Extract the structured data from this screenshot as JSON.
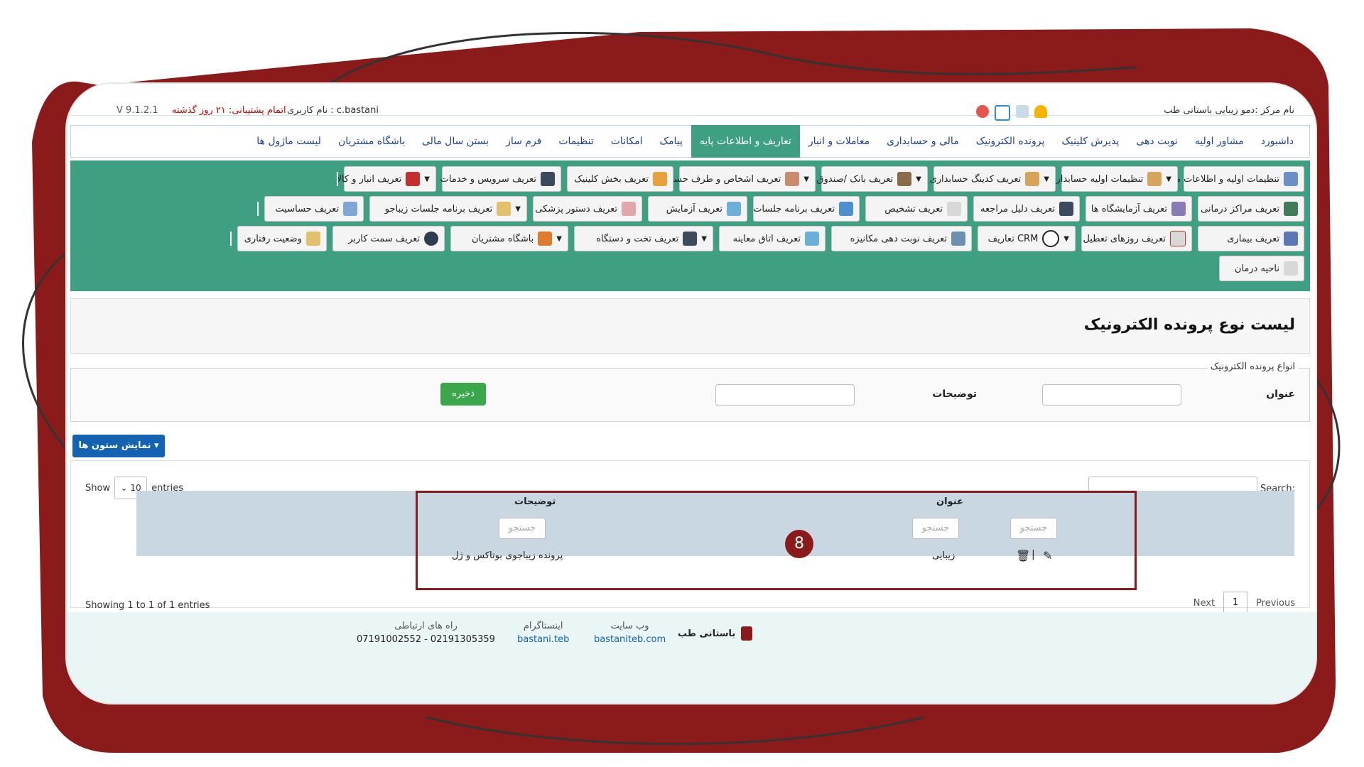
{
  "colors": {
    "accent": "#3f9f83",
    "frame": "#8b1a1a",
    "primary": "#1462b2",
    "save": "#3aa84a",
    "nav_text": "#1d3d8f"
  },
  "topbar": {
    "version": "V 9.1.2.1",
    "support": "اتمام پشتیبانی: ۲۱ روز گذشته",
    "user": "نام کاربری : c.bastani",
    "center": "نام مرکز :دمو زیبایی باستانی طب",
    "icons": [
      "power-icon",
      "checkbox-icon",
      "message-icon",
      "bell-icon"
    ]
  },
  "nav": {
    "items": [
      {
        "label": "داشبورد"
      },
      {
        "label": "مشاور اولیه"
      },
      {
        "label": "نوبت دهی"
      },
      {
        "label": "پذیرش کلینیک"
      },
      {
        "label": "پرونده الکترونیک"
      },
      {
        "label": "مالی و حسابداری"
      },
      {
        "label": "معاملات و انبار"
      },
      {
        "label": "تعاریف و اطلاعات پایه",
        "active": true
      },
      {
        "label": "پیامک"
      },
      {
        "label": "امکانات"
      },
      {
        "label": "تنظیمات"
      },
      {
        "label": "فرم ساز"
      },
      {
        "label": "بستن سال مالی"
      },
      {
        "label": "باشگاه مشتریان"
      },
      {
        "label": "لیست ماژول ها"
      }
    ]
  },
  "submenu": {
    "row1": [
      {
        "label": "تنظیمات اولیه و اطلاعات مرکز",
        "icon": "building-icon"
      },
      {
        "label": "تنظیمات اولیه حسابداری",
        "icon": "settings-icon",
        "dropdown": true
      },
      {
        "label": "تعریف کدینگ حسابداری",
        "icon": "coding-icon",
        "dropdown": true
      },
      {
        "label": "تعریف بانک /صندوق",
        "icon": "bank-icon",
        "dropdown": true
      },
      {
        "label": "تعریف اشخاص و طرف حساب",
        "icon": "person-icon",
        "dropdown": true
      },
      {
        "label": "تعریف بخش کلینیک",
        "icon": "grid-icon"
      },
      {
        "label": "تعریف سرویس و خدمات",
        "icon": "monitor-icon"
      },
      {
        "label": "تعریف انبار و کالا",
        "icon": "box-icon",
        "dropdown": true
      }
    ],
    "row2": [
      {
        "label": "تعریف مراکز درمانی",
        "icon": "clinic-icon"
      },
      {
        "label": "تعریف آزمایشگاه ها",
        "icon": "lab-icon"
      },
      {
        "label": "تعریف دلیل مراجعه",
        "icon": "reason-icon"
      },
      {
        "label": "تعریف تشخیص",
        "icon": "diagnosis-icon"
      },
      {
        "label": "تعریف برنامه جلسات",
        "icon": "checklist-icon"
      },
      {
        "label": "تعریف آزمایش",
        "icon": "flask-icon"
      },
      {
        "label": "تعریف دستور پزشکی",
        "icon": "bottle-icon"
      },
      {
        "label": "تعریف برنامه جلسات زیباجو",
        "icon": "beauty-icon",
        "dropdown": true
      },
      {
        "label": "تعریف حساسیت",
        "icon": "allergy-icon"
      }
    ],
    "row3": [
      {
        "label": "تعریف بیماری",
        "icon": "patient-icon"
      },
      {
        "label": "تعریف روزهای تعطیل",
        "icon": "calendar-icon"
      },
      {
        "label": "تعاریف CRM",
        "icon": "crm-icon",
        "dropdown": true
      },
      {
        "label": "تعریف نوبت دهی مکانیزه",
        "icon": "queue-icon"
      },
      {
        "label": "تعریف اتاق معاینه",
        "icon": "room-icon"
      },
      {
        "label": "تعریف تخت و دستگاه",
        "icon": "bed-icon",
        "dropdown": true
      },
      {
        "label": "باشگاه مشتریان",
        "icon": "group-icon",
        "dropdown": true
      },
      {
        "label": "تعریف سمت کاربر",
        "icon": "user-role-icon"
      },
      {
        "label": "وضعیت رفتاری",
        "icon": "behavior-icon"
      }
    ],
    "row4": [
      {
        "label": "ناحیه درمان",
        "icon": "body-icon"
      }
    ]
  },
  "page": {
    "title": "لیست نوع پرونده الکترونیک"
  },
  "form": {
    "legend": "انواع پرونده الکترونیک",
    "title_label": "عنوان",
    "desc_label": "توضیحات",
    "save": "ذخیره"
  },
  "columns_button": "نمایش ستون ها",
  "table": {
    "show": "Show",
    "entries_count": "10",
    "entries": "entries",
    "search_label": "Search:",
    "headers": {
      "title": "عنوان",
      "desc": "توضیحات"
    },
    "filter_placeholder": "جستجو",
    "rows": [
      {
        "title": "زیبایی",
        "desc": "پرونده زیباجوی بوتاکس و ژل"
      }
    ],
    "info": "Showing 1 to 1 of 1 entries",
    "pager": {
      "previous": "Previous",
      "current": "1",
      "next": "Next"
    },
    "badge": "8"
  },
  "footer": {
    "brand": "باستانی طب",
    "website_label": "وب سایت",
    "website": "bastaniteb.com",
    "instagram_label": "اینستاگرام",
    "instagram": "bastani.teb",
    "contact_label": "راه های ارتباطی",
    "contact": "07191002552 - 02191305359"
  }
}
